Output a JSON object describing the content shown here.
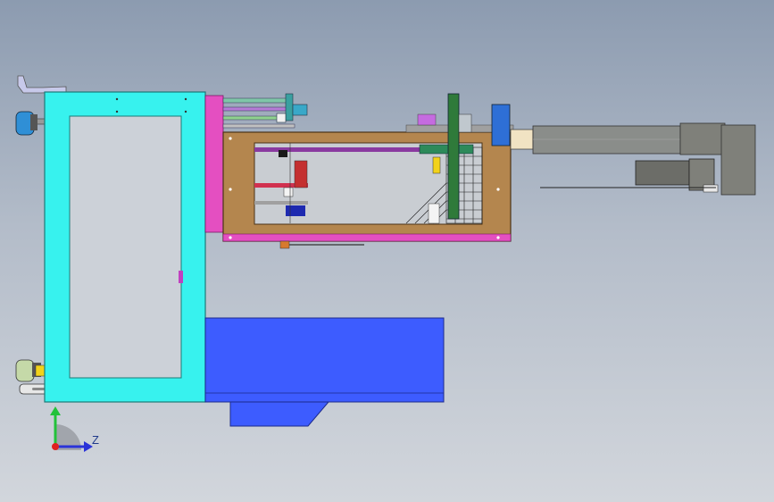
{
  "viewport": {
    "background_top": "#8c9bb0",
    "background_bottom": "#d2d6dc"
  },
  "colors": {
    "frame": "#37f2ee",
    "frame_outline": "#1d7a78",
    "base": "#3d5cff",
    "base_outline": "#1c2a8c",
    "box": "#b4864e",
    "box_rail": "#e44fc1",
    "cylinder": "#8a8d8a",
    "motor": "#7f807a",
    "mesh": "#1a1a1a",
    "disc": "#2f7a3a",
    "blue_block": "#2e6fd6"
  },
  "triad": {
    "axis_z": "Z",
    "axis_y_color": "#22c23a",
    "axis_z_color": "#2a33d8",
    "origin_color": "#e02020"
  }
}
